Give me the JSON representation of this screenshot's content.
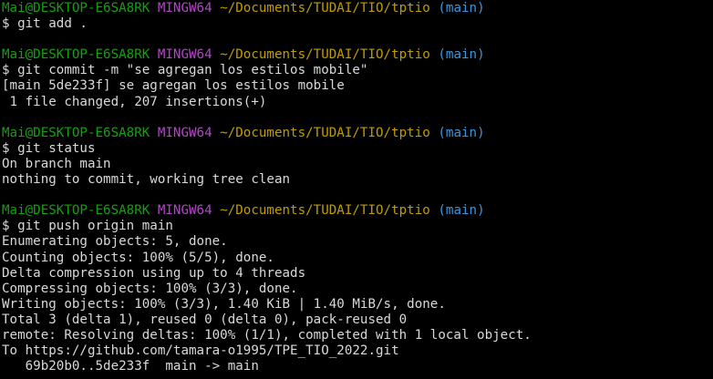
{
  "prompt": {
    "user_host": "Mai@DESKTOP-E6SA8RK",
    "system": "MINGW64",
    "path": "~/Documents/TUDAI/TIO/tptio",
    "branch": "(main)",
    "sign": "$"
  },
  "colors": {
    "background": "#000000",
    "text": "#d9d9d9",
    "user_host": "#13a10e",
    "system": "#b148c6",
    "path": "#c19c00",
    "branch": "#3a96dd"
  },
  "blocks": [
    {
      "command": "git add .",
      "output": []
    },
    {
      "command": "git commit -m \"se agregan los estilos mobile\"",
      "output": [
        "[main 5de233f] se agregan los estilos mobile",
        " 1 file changed, 207 insertions(+)"
      ]
    },
    {
      "command": "git status",
      "output": [
        "On branch main",
        "nothing to commit, working tree clean"
      ]
    },
    {
      "command": "git push origin main",
      "output": [
        "Enumerating objects: 5, done.",
        "Counting objects: 100% (5/5), done.",
        "Delta compression using up to 4 threads",
        "Compressing objects: 100% (3/3), done.",
        "Writing objects: 100% (3/3), 1.40 KiB | 1.40 MiB/s, done.",
        "Total 3 (delta 1), reused 0 (delta 0), pack-reused 0",
        "remote: Resolving deltas: 100% (1/1), completed with 1 local object.",
        "To https://github.com/tamara-o1995/TPE_TIO_2022.git",
        "   69b20b0..5de233f  main -> main"
      ]
    }
  ]
}
